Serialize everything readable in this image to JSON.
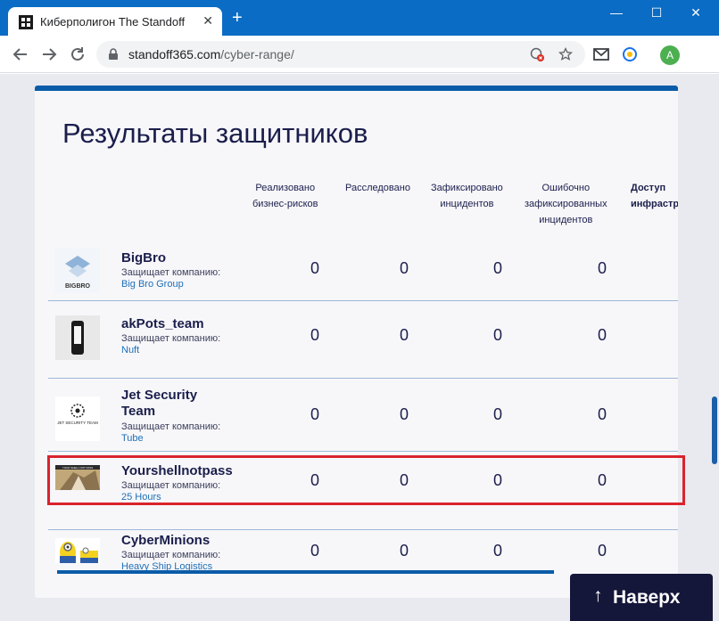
{
  "browser": {
    "tab_title": "Киберполигон The Standoff",
    "tab_close": "✕",
    "new_tab": "+",
    "minimize": "—",
    "maximize": "☐",
    "close": "✕",
    "url_host": "standoff365.com",
    "url_path": "/cyber-range/",
    "profile_initial": "A"
  },
  "page": {
    "title": "Результаты защитников",
    "up_button_arrow": "↑",
    "up_button_label": "Наверх"
  },
  "table": {
    "headers": [
      "Реализовано\nбизнес-рисков",
      "Расследовано",
      "Зафиксировано\nинцидентов",
      "Ошибочно\nзафиксированных\nинцидентов",
      "Доступ\nинфраструк"
    ],
    "defends_label": "Защищает компанию:",
    "rows": [
      {
        "team": "BigBro",
        "company": "Big Bro Group",
        "values": [
          "0",
          "0",
          "0",
          "0"
        ],
        "logo_text": "BIGBRO"
      },
      {
        "team": "akPots_team",
        "company": "Nuft",
        "values": [
          "0",
          "0",
          "0",
          "0"
        ],
        "logo_text": ""
      },
      {
        "team": "Jet Security\nTeam",
        "company": "Tube",
        "values": [
          "0",
          "0",
          "0",
          "0"
        ],
        "logo_text": "JET SECURITY TEAM"
      },
      {
        "team": "Yourshellnotpass",
        "company": "25 Hours",
        "values": [
          "0",
          "0",
          "0",
          "0"
        ],
        "logo_text": "YOUR SHELL NOT PASS"
      },
      {
        "team": "CyberMinions",
        "company": "Heavy Ship Logistics",
        "values": [
          "0",
          "0",
          "0",
          "0"
        ],
        "logo_text": ""
      }
    ]
  },
  "colors": {
    "accent": "#0a5ca8",
    "highlight": "#d9232d",
    "text_dark": "#1b1e4b",
    "link": "#1f6fb5"
  }
}
